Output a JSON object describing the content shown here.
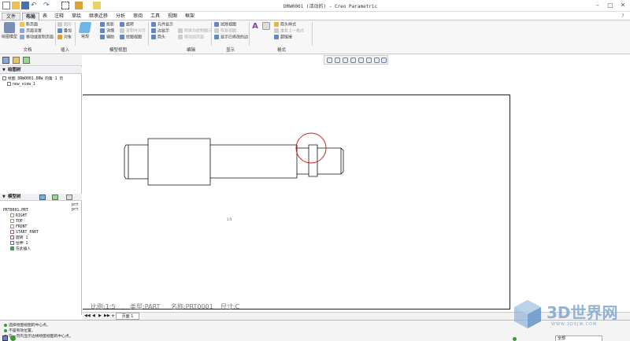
{
  "window": {
    "title": "DRW0001 (活动的) - Creo Parametric",
    "minimize": "–",
    "maximize": "□",
    "close": "✕"
  },
  "menu": {
    "tabs": [
      "文件",
      "布局",
      "表",
      "注释",
      "草绘",
      "继承迁移",
      "分析",
      "审阅",
      "工具",
      "视图",
      "框架"
    ]
  },
  "ribbon": {
    "document": {
      "title": "文档",
      "items": [
        "新页面",
        "页面设置",
        "移动或复制页面"
      ],
      "big_label": "绘图模型"
    },
    "insert": {
      "title": "插入",
      "items": [
        "图形",
        "叠加",
        "对象"
      ]
    },
    "model_views": {
      "title": "模型视图",
      "big_label": "常规",
      "items": [
        "投影",
        "旋转",
        "详细",
        "复制并对齐",
        "辅助",
        "绘图视图"
      ]
    },
    "edit": {
      "title": "编辑",
      "items": [
        "元件显示",
        "边显示",
        "箭头",
        "转换为绘制图元",
        "移动到页面",
        "拭除视图"
      ]
    },
    "display": {
      "title": "显示",
      "items": [
        "拭除视图",
        "恢复视图",
        "显示已修改的边"
      ]
    },
    "format": {
      "title": "格式",
      "items": [
        "箭头样式",
        "重复上一格式",
        "超链接"
      ]
    }
  },
  "left_panel": {
    "drawing_tree_header": "绘图树",
    "drawing_tree_items": [
      "绘图 DRW0001.DRW 的第 1 页",
      "new_view_1"
    ],
    "model_tree_header": "模型树",
    "model_tree_items": [
      "PRT0001.PRT",
      "RIGHT",
      "TOP",
      "FRONT",
      "START_PART",
      "旋转 1",
      "拉伸 1",
      "在此插入"
    ],
    "model_tree_col": "prt"
  },
  "drawing": {
    "scale_text": "比例:1:5",
    "type_text": "类型:PART",
    "name_text": "名称:PRT0001",
    "size_text": "尺寸:C",
    "note_mark": "1:5"
  },
  "sheet_tab": {
    "label": "页面 1"
  },
  "status": {
    "messages": [
      "选择绘图视图的中心点。",
      "不是有效位置。",
      "在一页内显示边线绘图视图的中心点。"
    ],
    "mode": "全部"
  },
  "watermark": {
    "title": "3D世界网",
    "url": "WWW.3DSJW.COM"
  },
  "colors": {
    "highlight_circle": "#cc2222",
    "ribbon_bg": "#f7f7f7",
    "active_tab": "#e9eef5"
  }
}
